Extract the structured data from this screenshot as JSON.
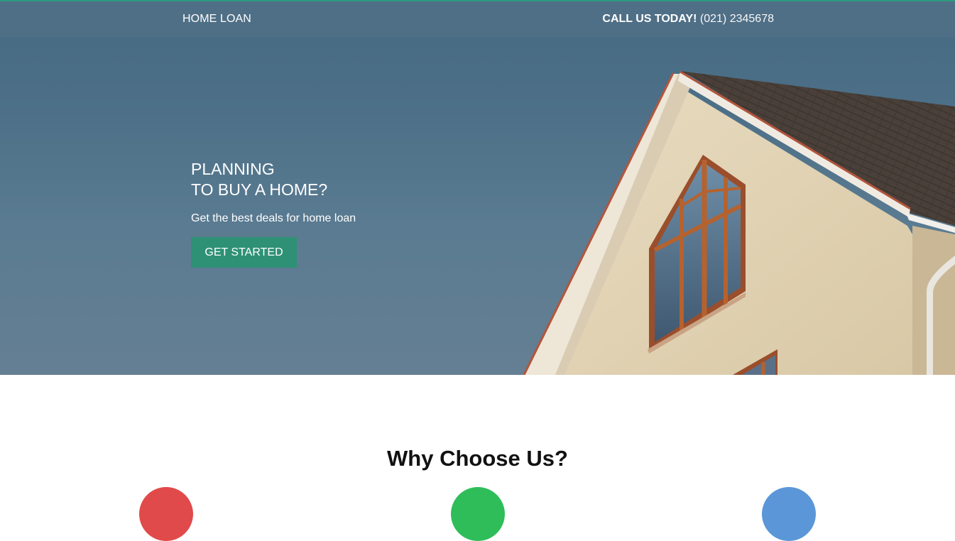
{
  "nav": {
    "brand": "HOME LOAN",
    "call_label": "CALL US TODAY!",
    "call_number": "(021) 2345678"
  },
  "hero": {
    "headline_line1": "PLANNING",
    "headline_line2": "TO BUY A HOME?",
    "subtext": "Get the best deals for home loan",
    "cta_label": "GET STARTED"
  },
  "why": {
    "title": "Why Choose Us?"
  },
  "colors": {
    "accent": "#2e9176",
    "feature_red": "#e14a4a",
    "feature_green": "#2fbd5a",
    "feature_blue": "#5b97d8"
  }
}
